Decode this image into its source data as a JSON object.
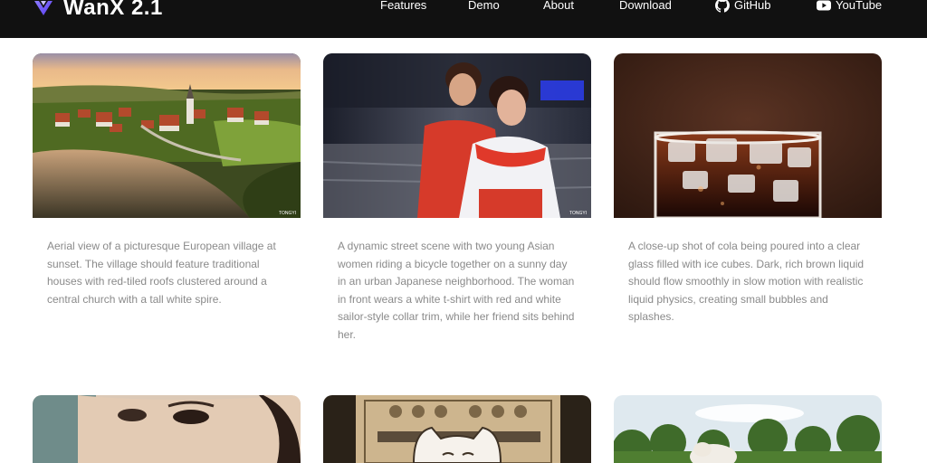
{
  "app": {
    "title": "WanX 2.1",
    "logo_icon": "wanx-logo-icon"
  },
  "nav": {
    "items": [
      {
        "label": "Features"
      },
      {
        "label": "Demo"
      },
      {
        "label": "About"
      },
      {
        "label": "Download"
      },
      {
        "label": "GitHub",
        "icon": "github-icon"
      },
      {
        "label": "YouTube",
        "icon": "youtube-icon"
      }
    ]
  },
  "cards": [
    {
      "image": "european-village-sunset-video",
      "caption": "Aerial view of a picturesque European village at sunset. The village should feature traditional houses with red-tiled roofs clustered around a central church with a tall white spire.",
      "watermark": "TONGYI"
    },
    {
      "image": "street-bicycle-video",
      "caption": "A dynamic street scene with two young Asian women riding a bicycle together on a sunny day in an urban Japanese neighborhood. The woman in front wears a white t-shirt with red and white sailor-style collar trim, while her friend sits behind her.",
      "watermark": "TONGYI"
    },
    {
      "image": "cola-pour-video",
      "caption": "A close-up shot of cola being poured into a clear glass filled with ice cubes. Dark, rich brown liquid should flow smoothly in slow motion with realistic liquid physics, creating small bubbles and splashes."
    },
    {
      "image": "woman-closeup-video"
    },
    {
      "image": "cartoon-cat-poster-video"
    },
    {
      "image": "dog-in-field-video"
    }
  ],
  "colors": {
    "nav_background": "#111111",
    "caption_text": "#8a8a8a",
    "page_background": "#ffffff"
  }
}
